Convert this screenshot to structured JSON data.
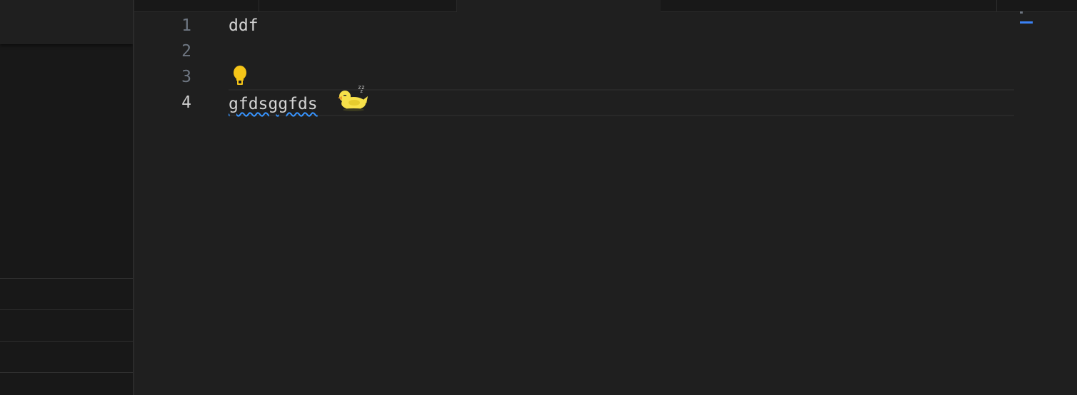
{
  "editor": {
    "line_numbers": [
      "1",
      "2",
      "3",
      "4"
    ],
    "current_line": "4",
    "lines": {
      "l1": "ddf",
      "l2": "",
      "l3": "",
      "l4": "gfdsggfds"
    },
    "icons": [
      "lightbulb-icon",
      "duck-icon"
    ],
    "colors": {
      "background": "#1f1f1f",
      "sidebar": "#181818",
      "text": "#d4d4d4",
      "line_number": "#6e7681",
      "squiggle": "#3794ff",
      "lightbulb": "#f5c518",
      "duck": "#f7e14a"
    }
  }
}
